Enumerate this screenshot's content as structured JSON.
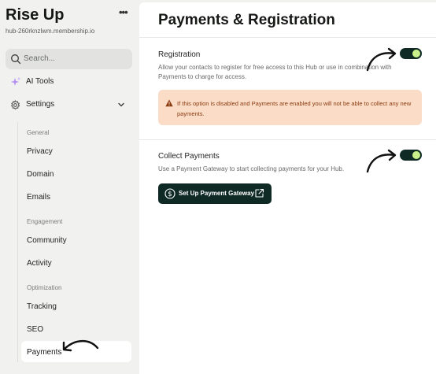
{
  "sidebar": {
    "brand": "Rise Up",
    "brand_menu": "•••",
    "hub_url": "hub-260rknzlwm.membership.io",
    "search_placeholder": "Search...",
    "ai_tools_label": "AI Tools",
    "settings_label": "Settings",
    "groups": {
      "general": "General",
      "engagement": "Engagement",
      "optimization": "Optimization"
    },
    "items": {
      "privacy": "Privacy",
      "domain": "Domain",
      "emails": "Emails",
      "community": "Community",
      "activity": "Activity",
      "tracking": "Tracking",
      "seo": "SEO",
      "payments": "Payments"
    }
  },
  "main": {
    "title": "Payments & Registration",
    "registration": {
      "title": "Registration",
      "description": "Allow your contacts to register for free access to this Hub or use in combination with Payments to charge for access.",
      "toggle_on": true,
      "warning": "If this option is disabled and Payments are enabled you will not be able to collect any new payments."
    },
    "collect_payments": {
      "title": "Collect Payments",
      "description": "Use a Payment Gateway to start collecting payments for your Hub.",
      "toggle_on": true,
      "button_label": "Set Up Payment Gateway"
    }
  },
  "colors": {
    "sidebar_bg": "#f1f1ef",
    "accent_dark": "#0f2a25",
    "toggle_knob": "#c9f08a",
    "warning_bg": "#fbdcc6",
    "warning_text": "#8a3b12"
  },
  "icons": [
    "search-icon",
    "sparkle-icon",
    "gear-icon",
    "chevron-down-icon",
    "warning-icon",
    "dollar-icon",
    "external-link-icon",
    "arrow-annotation-icon"
  ]
}
